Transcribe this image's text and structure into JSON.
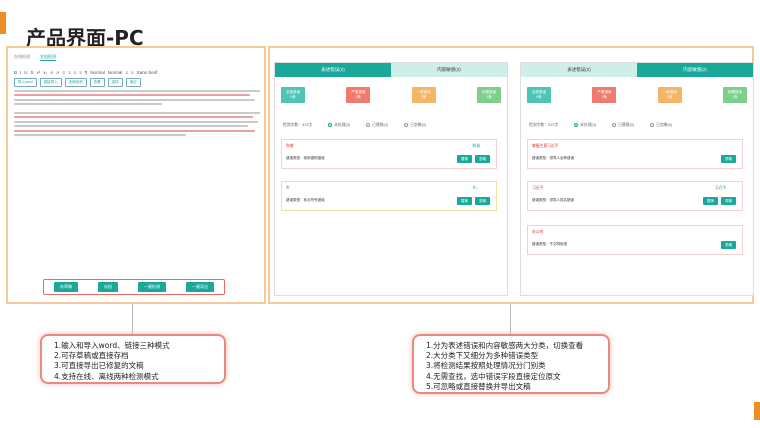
{
  "title": "产品界面-PC",
  "editor": {
    "tabs": [
      "在线检测",
      "文档检测"
    ],
    "toolbar": [
      "B",
      "I",
      "U",
      "S",
      "x²",
      "x₂",
      "A",
      "A",
      "≡",
      "≡",
      "≡",
      "≡",
      "¶",
      "Normal",
      "Normal",
      "≡",
      "≡",
      "Sans Serif"
    ],
    "subtoolbar": [
      "导入word",
      "链接导入",
      "全局检测",
      "查看",
      "选择",
      "清空"
    ],
    "buttons": [
      "存草稿",
      "存档",
      "一键检测",
      "一键导出"
    ]
  },
  "review": {
    "tabs": [
      "表述错误(2)",
      "内容敏感(2)"
    ],
    "cards": [
      {
        "label": "全部错误",
        "count": "4条",
        "color": "#4fc3b5"
      },
      {
        "label": "严重错误",
        "count": "2条",
        "color": "#f07a6b"
      },
      {
        "label": "一般错误",
        "count": "2条",
        "color": "#f4b566"
      },
      {
        "label": "轻微错误",
        "count": "1条",
        "color": "#7cd08c"
      }
    ],
    "filters": [
      "检测字数：313字",
      "未处理(3)",
      "已替换(0)",
      "已忽略(0)"
    ],
    "panel_a_issues": [
      {
        "word": "和谱",
        "sugg": "和谐",
        "kind": "错误类型：常用错别错误",
        "style": "r"
      },
      {
        "word": "乡",
        "sugg": "乡。",
        "kind": "错误类型：标点符号错误",
        "style": "y"
      }
    ],
    "panel_b_issues": [
      {
        "word": "掌握生意习近平",
        "sugg": "",
        "kind": "错误类型：领导人全称错误",
        "style": "r"
      },
      {
        "word": "习近平",
        "sugg": "习近平",
        "kind": "错误类型：领导人姓名错误",
        "style": "r"
      },
      {
        "word": "毛公的",
        "sugg": "",
        "kind": "错误类型：不文明用语",
        "style": "r"
      }
    ],
    "actions": [
      "替换",
      "忽略"
    ]
  },
  "callouts": {
    "left": [
      "1.输入和导入word、链接三种模式",
      "2.可存草稿或直接存档",
      "3.可直接导出已修复的文稿",
      "4.支持在线、离线两种检测模式"
    ],
    "right": [
      "1.分为表述错误和内容敏感两大分类，切换查看",
      "2.大分类下又细分为多种错误类型",
      "3.将检测结果按照处理情况分门别类",
      "4.无需查找，选中错误字段直接定位原文",
      "5.可忽略或直接替换并导出文稿"
    ]
  },
  "colors": {
    "accent": "#f08c28",
    "teal": "#1aa89b",
    "panel_border": "#f5c99a",
    "callout_border": "#e98a7e"
  }
}
